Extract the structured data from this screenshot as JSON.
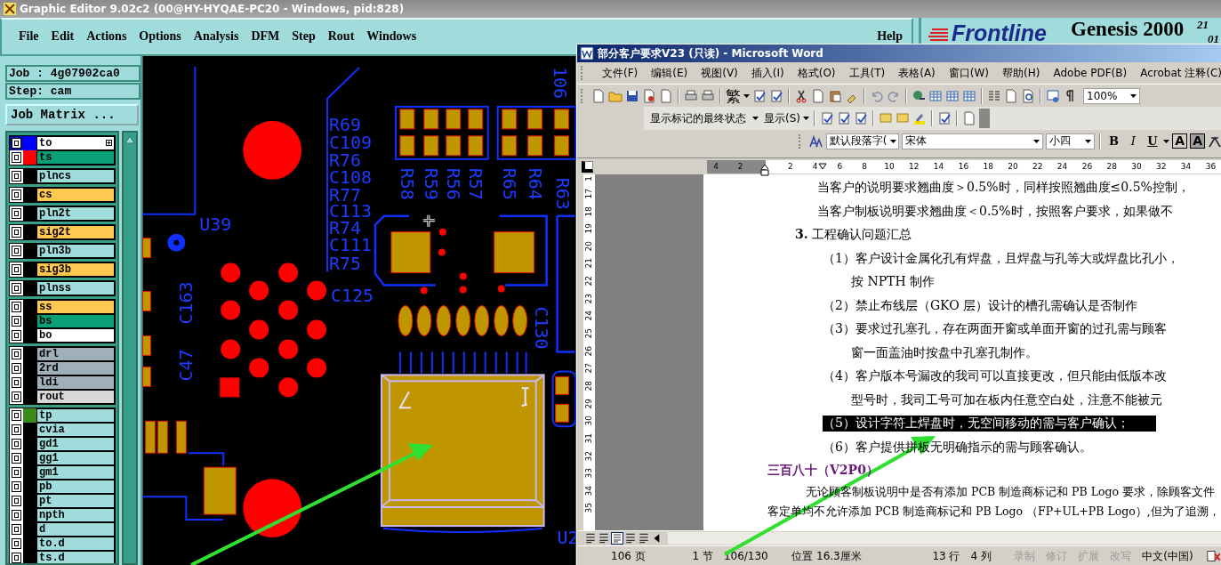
{
  "window": {
    "title": "Graphic Editor 9.02c2 (00@HY-HYQAE-PC20 - Windows, pid:828)"
  },
  "menu": [
    "File",
    "Edit",
    "Actions",
    "Options",
    "Analysis",
    "DFM",
    "Step",
    "Rout",
    "Windows"
  ],
  "help_menu": "Help",
  "brand": {
    "logo": "Frontline",
    "product": "Genesis 2000",
    "line_1": "21",
    "line_2": "01"
  },
  "job_panel": {
    "job": "Job : 4g07902ca0",
    "step": "Step: cam",
    "matrix_button": "Job Matrix ..."
  },
  "layer_groups": [
    [
      {
        "name": "to",
        "color": "#ffffff",
        "swatch": {
          "color": "#0000ff"
        },
        "checked": true,
        "selected": true
      },
      {
        "name": "ts",
        "color": "#0aa078",
        "swatch": {
          "color": "#ff0000"
        },
        "checked": true,
        "selected": false
      }
    ],
    [
      {
        "name": "plncs",
        "color": "#a0dcdc",
        "checked": true,
        "selected": false
      }
    ],
    [
      {
        "name": "cs",
        "color": "#ffc850",
        "checked": true,
        "selected": false
      }
    ],
    [
      {
        "name": "pln2t",
        "color": "#a0dcdc",
        "checked": true,
        "selected": false
      }
    ],
    [
      {
        "name": "sig2t",
        "color": "#ffc850",
        "checked": true,
        "selected": false
      }
    ],
    [
      {
        "name": "pln3b",
        "color": "#a0dcdc",
        "checked": true,
        "selected": false
      }
    ],
    [
      {
        "name": "sig3b",
        "color": "#ffc850",
        "checked": true,
        "selected": false
      }
    ],
    [
      {
        "name": "plnss",
        "color": "#a0dcdc",
        "checked": true,
        "selected": false
      }
    ],
    [
      {
        "name": "ss",
        "color": "#ffc850",
        "checked": true,
        "selected": false
      },
      {
        "name": "bs",
        "color": "#0aa078",
        "checked": true,
        "selected": false
      },
      {
        "name": "bo",
        "color": "#ffffff",
        "checked": true,
        "selected": false
      }
    ],
    [
      {
        "name": "drl",
        "color": "#a0b0b8",
        "checked": true,
        "selected": false
      },
      {
        "name": "2rd",
        "color": "#a0b0b8",
        "checked": true,
        "selected": false
      },
      {
        "name": "ldi",
        "color": "#a0b0b8",
        "checked": true,
        "selected": false
      },
      {
        "name": "rout",
        "color": "#d8d8d8",
        "checked": true,
        "selected": false
      }
    ],
    [
      {
        "name": "tp",
        "color": "#a0dcdc",
        "swatch": {
          "color": "#3c8c1c"
        },
        "checked": true,
        "selected": false
      },
      {
        "name": "cvia",
        "color": "#a0dcdc",
        "checked": true,
        "selected": false
      },
      {
        "name": "gd1",
        "color": "#a0dcdc",
        "checked": true,
        "selected": false
      },
      {
        "name": "gg1",
        "color": "#a0dcdc",
        "checked": true,
        "selected": false
      },
      {
        "name": "gm1",
        "color": "#a0dcdc",
        "checked": true,
        "selected": false
      },
      {
        "name": "pb",
        "color": "#a0dcdc",
        "checked": true,
        "selected": false
      },
      {
        "name": "pt",
        "color": "#a0dcdc",
        "checked": true,
        "selected": false
      },
      {
        "name": "npth",
        "color": "#a0dcdc",
        "checked": true,
        "selected": false
      },
      {
        "name": "d",
        "color": "#a0dcdc",
        "checked": true,
        "selected": false
      },
      {
        "name": "to.d",
        "color": "#a0dcdc",
        "checked": true,
        "selected": false
      },
      {
        "name": "ts.d",
        "color": "#a0dcdc",
        "checked": true,
        "selected": false
      }
    ]
  ],
  "canvas_labels": [
    "106",
    "R69",
    "C109",
    "R76",
    "C108",
    "R77",
    "C113",
    "R74",
    "C111",
    "R75",
    "U39",
    "C125",
    "C163",
    "C47",
    "R58",
    "R59",
    "R56",
    "R57",
    "R65",
    "R64",
    "R63",
    "C130",
    "U2"
  ],
  "word": {
    "title": "部分客户要求V23 (只读) - Microsoft Word",
    "menu": [
      "文件(F)",
      "编辑(E)",
      "视图(V)",
      "插入(I)",
      "格式(O)",
      "工具(T)",
      "表格(A)",
      "窗口(W)",
      "帮助(H)",
      "Adobe PDF(B)",
      "Acrobat 注释(C)"
    ],
    "traditional_button": "繁",
    "zoom": "100%",
    "markup_view": "显示标记的最终状态",
    "show_menu": "显示(S)",
    "style": "默认段落字(",
    "font": "宋体",
    "size": "小四",
    "format_buttons": [
      "B",
      "I",
      "U"
    ],
    "char_buttons": [
      "A",
      "A"
    ],
    "ruler": [
      "4",
      "2",
      "2",
      "4",
      "6",
      "8",
      "10",
      "12",
      "14",
      "16",
      "18",
      "20",
      "22",
      "24",
      "26",
      "28",
      "30",
      "32",
      "34",
      "36"
    ],
    "side_ruler": [
      "1",
      "17",
      "18",
      "19",
      "20",
      "21",
      "22",
      "23",
      "24",
      "25",
      "26",
      "27",
      "28",
      "29",
      "30",
      "31",
      "32",
      "33",
      "34",
      "35"
    ],
    "lines": [
      {
        "kind": "line",
        "text": "当客户的说明要求翘曲度＞0.5%时，同样按照翘曲度≤0.5%控制，",
        "selected": false
      },
      {
        "kind": "line",
        "text": "当客户制板说明要求翘曲度＜0.5%时，按照客户要求，如果做不",
        "selected": false
      },
      {
        "kind": "heading",
        "text": "**3.** 工程确认问题汇总",
        "selected": false
      },
      {
        "kind": "item",
        "text": "（1）客户设计金属化孔有焊盘，且焊盘与孔等大或焊盘比孔小，",
        "selected": false
      },
      {
        "kind": "continuation",
        "text": "按 NPTH 制作",
        "selected": false
      },
      {
        "kind": "item",
        "text": "（2）禁止布线层（GKO 层）设计的槽孔需确认是否制作",
        "selected": false
      },
      {
        "kind": "item",
        "text": "（3）要求过孔塞孔，存在两面开窗或单面开窗的过孔需与顾客",
        "selected": false
      },
      {
        "kind": "continuation",
        "text": "窗一面盖油时按盘中孔塞孔制作。",
        "selected": false
      },
      {
        "kind": "item",
        "text": "（4）客户版本号漏改的我司可以直接更改，但只能由低版本改",
        "selected": false
      },
      {
        "kind": "continuation",
        "text": "型号时，我司工号可加在板内任意空白处，注意不能被元",
        "selected": false
      },
      {
        "kind": "item",
        "text": "（5）设计字符上焊盘时，无空间移动的需与客户确认；",
        "selected": true
      },
      {
        "kind": "item",
        "text": "（6）客户提供拼板无明确指示的需与顾客确认。",
        "selected": false
      },
      {
        "kind": "section",
        "text": "三百八十（V2P0）",
        "selected": false
      },
      {
        "kind": "para_first",
        "text": "无论顾客制板说明中是否有添加 PCB 制造商标记和 PB Logo 要求，除顾客文件",
        "selected": false
      },
      {
        "kind": "para",
        "text": "客定单均不允许添加 PCB 制造商标记和 PB Logo （FP+UL+PB Logo）,但为了追溯，",
        "selected": false
      }
    ],
    "status": [
      {
        "text": "106 页",
        "disabled": false
      },
      {
        "text": "1 节",
        "disabled": false
      },
      {
        "text": "106/130",
        "disabled": false
      },
      {
        "text": "位置 16.3厘米",
        "disabled": false
      },
      {
        "text": "13 行",
        "disabled": false
      },
      {
        "text": "4 列",
        "disabled": false
      },
      {
        "text": "录制",
        "disabled": true
      },
      {
        "text": "修订",
        "disabled": true
      },
      {
        "text": "扩展",
        "disabled": true
      },
      {
        "text": "改写",
        "disabled": true
      },
      {
        "text": "中文(中国)",
        "disabled": false
      }
    ]
  }
}
